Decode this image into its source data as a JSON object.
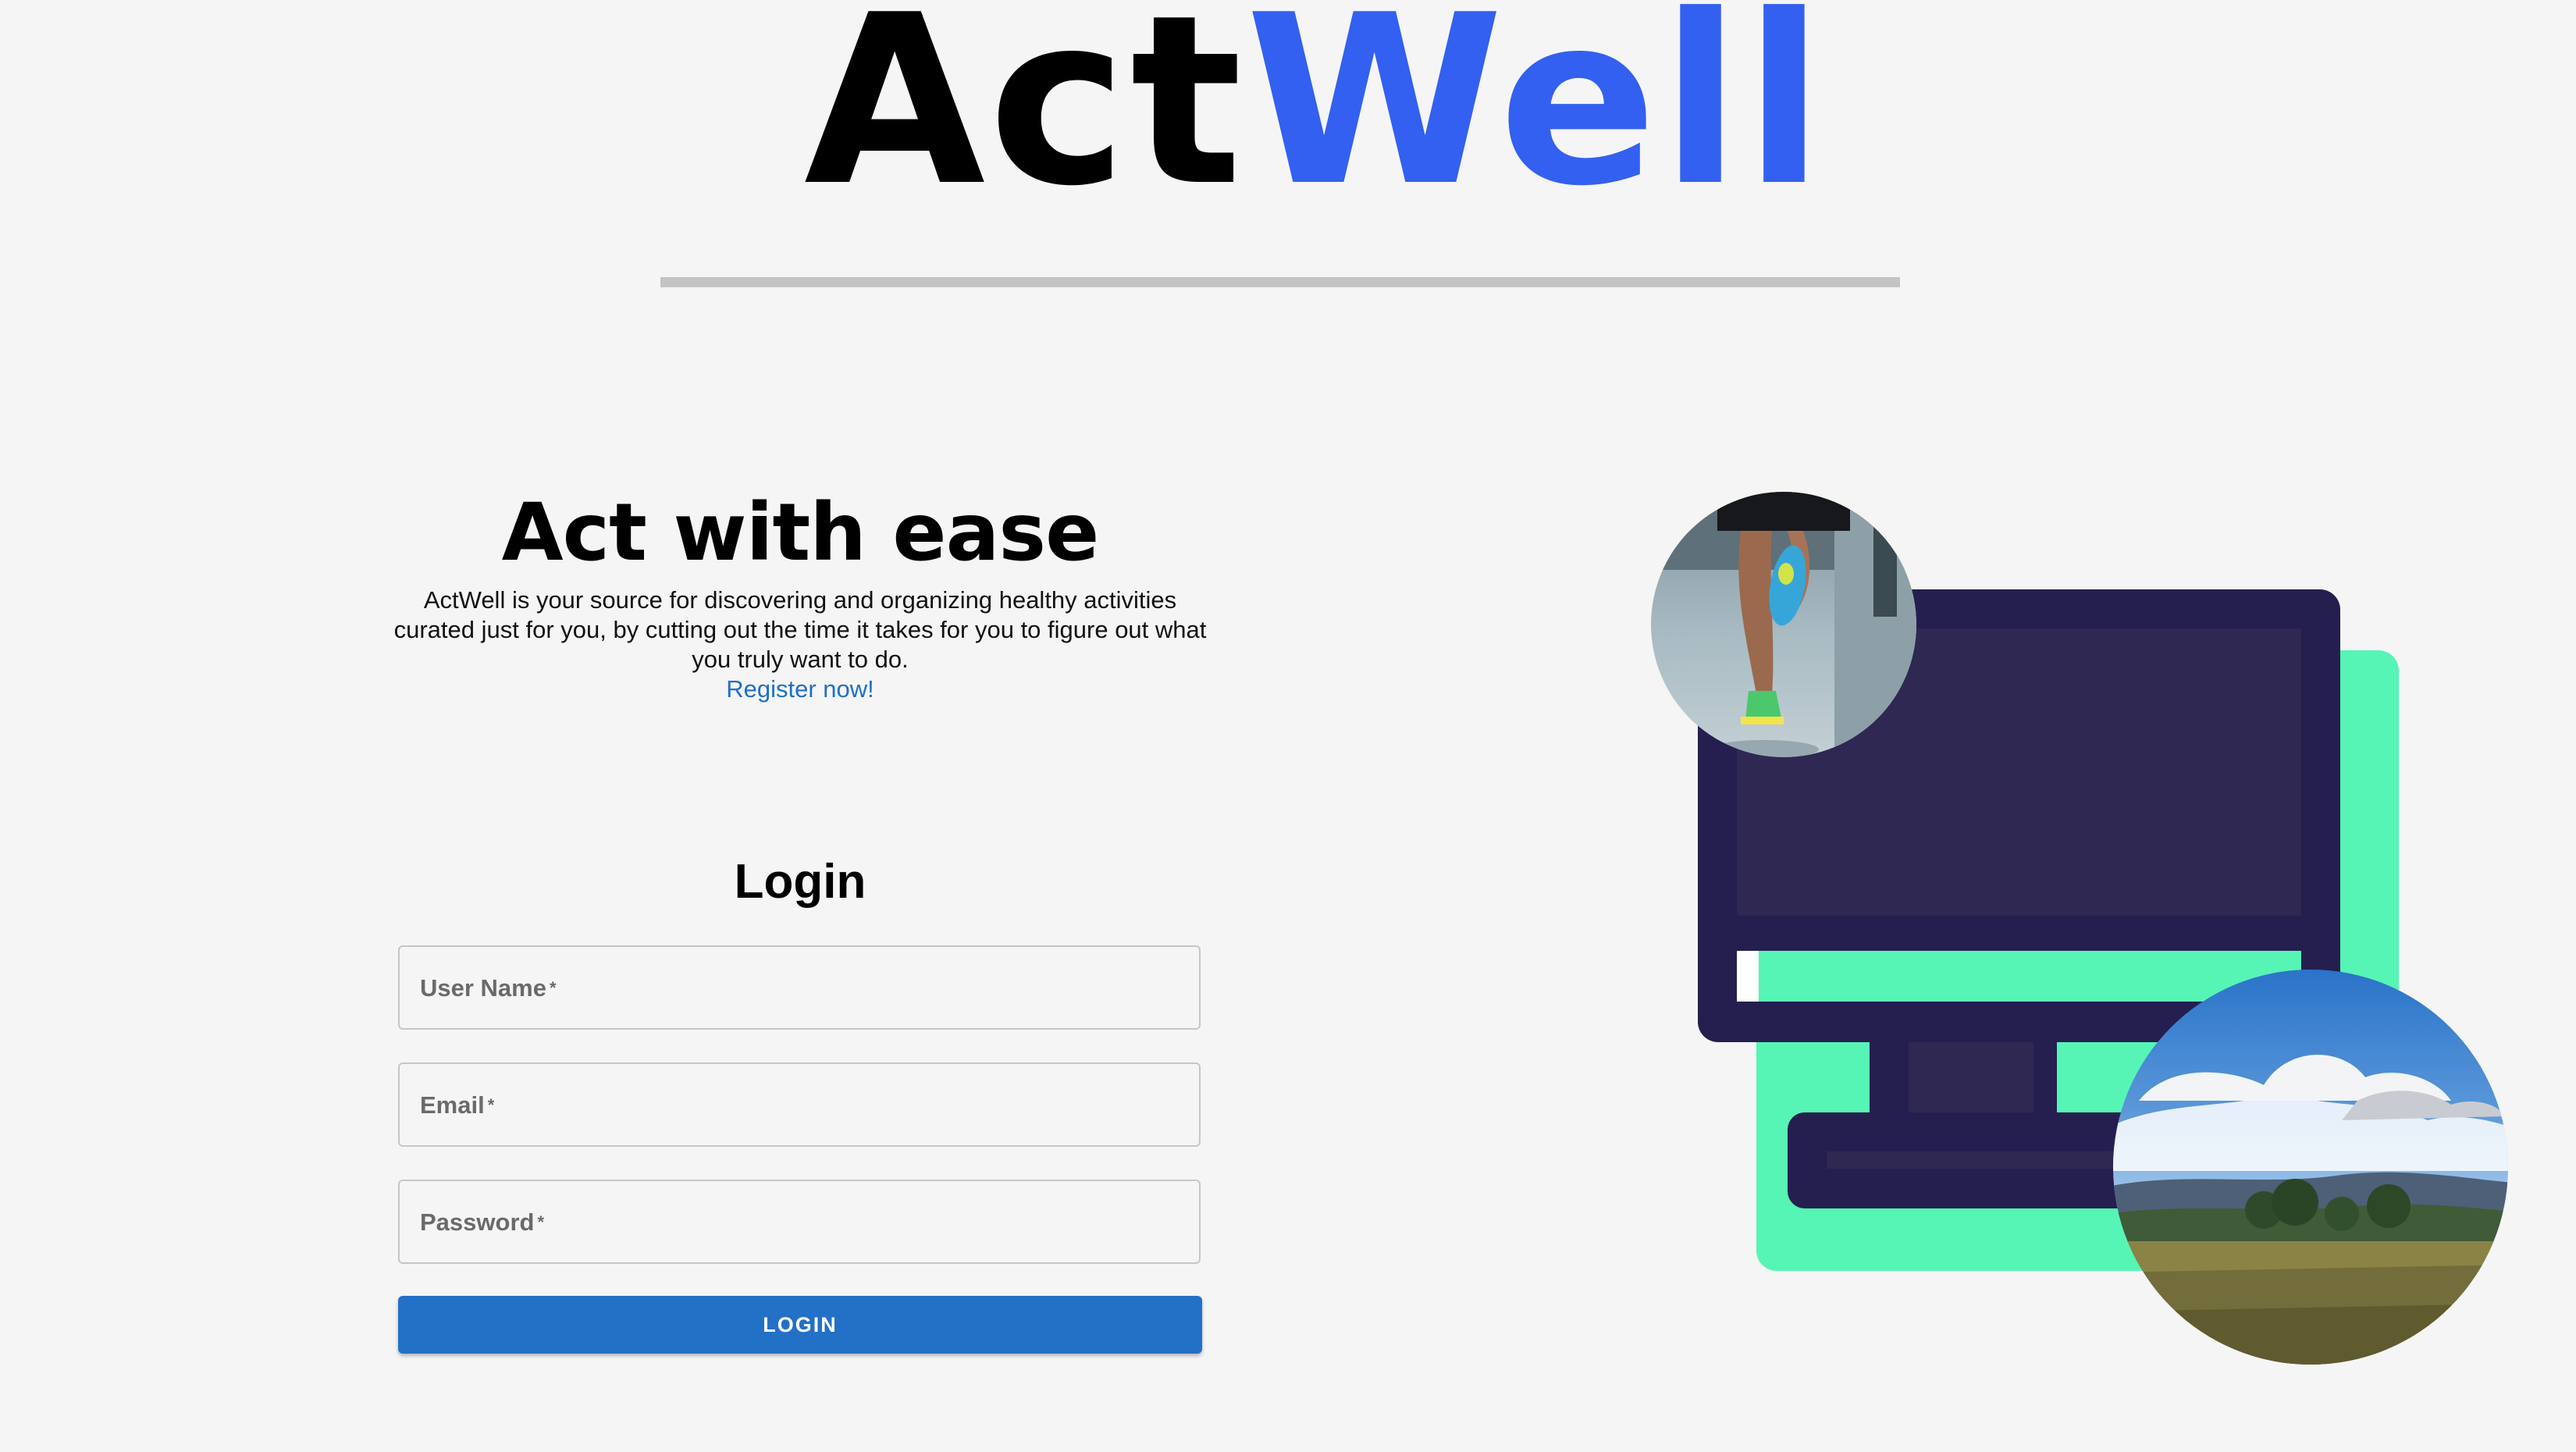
{
  "brand": {
    "name_part_a": "Act",
    "name_part_b": "Well",
    "accent_color": "#3360f0"
  },
  "hero": {
    "title": "Act with ease",
    "description": "ActWell is your source for discovering and organizing healthy activities curated just for you, by cutting out the time it takes for you to figure out what you truly want to do.",
    "register_link": "Register now!"
  },
  "login": {
    "title": "Login",
    "fields": [
      {
        "label": "User Name",
        "required_mark": "*",
        "value": ""
      },
      {
        "label": "Email",
        "required_mark": "*",
        "value": ""
      },
      {
        "label": "Password",
        "required_mark": "*",
        "value": ""
      }
    ],
    "submit_label": "LOGIN"
  },
  "illustration": {
    "icons": [
      "monitor-icon",
      "runner-photo",
      "landscape-photo"
    ],
    "colors": {
      "monitor_dark": "#241f4f",
      "monitor_screen": "#2e2852",
      "accent_green": "#56f5b5"
    }
  }
}
